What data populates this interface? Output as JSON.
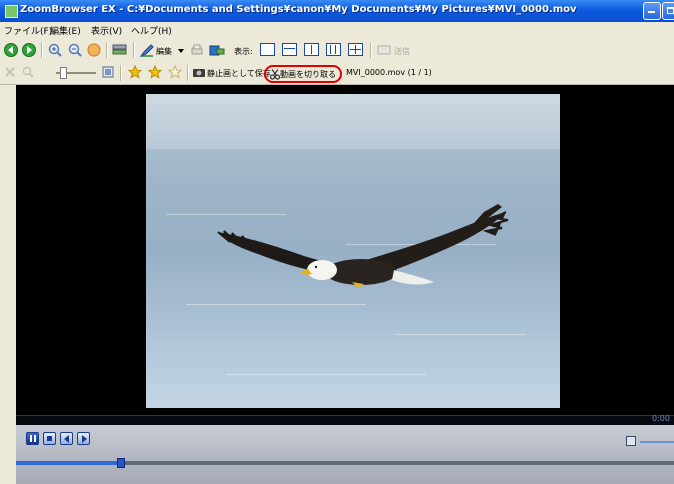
{
  "window": {
    "title": "ZoomBrowser EX - C:¥Documents and Settings¥canon¥My Documents¥My Pictures¥MVI_0000.mov"
  },
  "menu": {
    "items": [
      "ファイル(F)",
      "編集(E)",
      "表示(V)",
      "ヘルプ(H)"
    ]
  },
  "toolbar1": {
    "edit_label": "編集",
    "display_label": "表示:",
    "disabled_label": "送信"
  },
  "toolbar2": {
    "save_still_label": "静止画として保存",
    "cut_movie_label": "動画を切り取る",
    "file_info": "MVI_0000.mov  (1 / 1)"
  },
  "player": {
    "time": "0:00",
    "seek_fraction": 0.16
  },
  "colors": {
    "titlebar": "#0b5ae0",
    "highlight": "#e00000",
    "viewer_bg": "#000000"
  }
}
